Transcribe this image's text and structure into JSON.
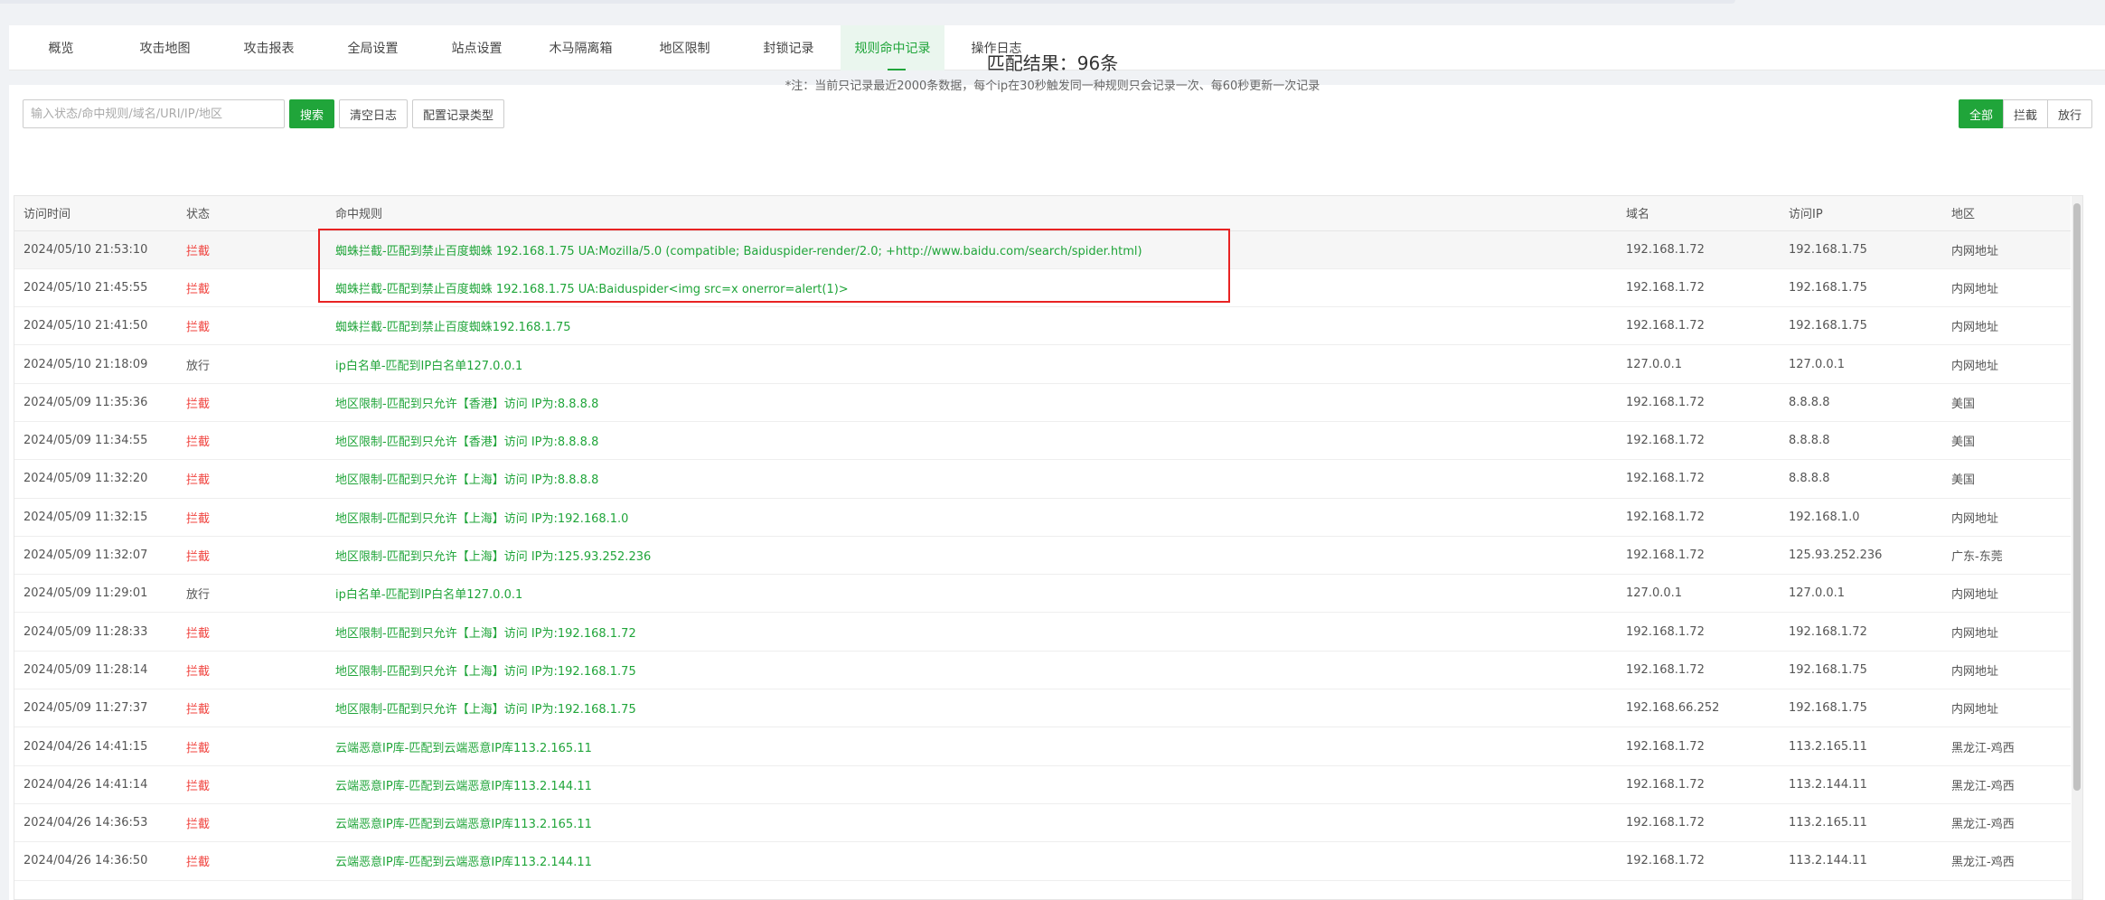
{
  "tabs": [
    "概览",
    "攻击地图",
    "攻击报表",
    "全局设置",
    "站点设置",
    "木马隔离箱",
    "地区限制",
    "封锁记录",
    "规则命中记录",
    "操作日志"
  ],
  "toolbar": {
    "search_placeholder": "输入状态/命中规则/域名/URI/IP/地区",
    "search_label": "搜索",
    "clear_label": "清空日志",
    "config_label": "配置记录类型"
  },
  "filters": [
    "全部",
    "拦截",
    "放行"
  ],
  "result": {
    "title": "匹配结果：96条",
    "note": "*注：当前只记录最近2000条数据，每个ip在30秒触发同一种规则只会记录一次、每60秒更新一次记录"
  },
  "columns": [
    "访问时间",
    "状态",
    "命中规则",
    "域名",
    "访问IP",
    "地区"
  ],
  "rows": [
    {
      "time": "2024/05/10 21:53:10",
      "status": "拦截",
      "rule": "蜘蛛拦截-匹配到禁止百度蜘蛛 192.168.1.75 UA:Mozilla/5.0 (compatible; Baiduspider-render/2.0; +http://www.baidu.com/search/spider.html)",
      "domain": "192.168.1.72",
      "ip": "192.168.1.75",
      "region": "内网地址"
    },
    {
      "time": "2024/05/10 21:45:55",
      "status": "拦截",
      "rule": "蜘蛛拦截-匹配到禁止百度蜘蛛 192.168.1.75 UA:Baiduspider<img src=x onerror=alert(1)>",
      "domain": "192.168.1.72",
      "ip": "192.168.1.75",
      "region": "内网地址"
    },
    {
      "time": "2024/05/10 21:41:50",
      "status": "拦截",
      "rule": "蜘蛛拦截-匹配到禁止百度蜘蛛192.168.1.75",
      "domain": "192.168.1.72",
      "ip": "192.168.1.75",
      "region": "内网地址"
    },
    {
      "time": "2024/05/10 21:18:09",
      "status": "放行",
      "rule": "ip白名单-匹配到IP白名单127.0.0.1",
      "domain": "127.0.0.1",
      "ip": "127.0.0.1",
      "region": "内网地址"
    },
    {
      "time": "2024/05/09 11:35:36",
      "status": "拦截",
      "rule": "地区限制-匹配到只允许【香港】访问 IP为:8.8.8.8",
      "domain": "192.168.1.72",
      "ip": "8.8.8.8",
      "region": "美国"
    },
    {
      "time": "2024/05/09 11:34:55",
      "status": "拦截",
      "rule": "地区限制-匹配到只允许【香港】访问 IP为:8.8.8.8",
      "domain": "192.168.1.72",
      "ip": "8.8.8.8",
      "region": "美国"
    },
    {
      "time": "2024/05/09 11:32:20",
      "status": "拦截",
      "rule": "地区限制-匹配到只允许【上海】访问 IP为:8.8.8.8",
      "domain": "192.168.1.72",
      "ip": "8.8.8.8",
      "region": "美国"
    },
    {
      "time": "2024/05/09 11:32:15",
      "status": "拦截",
      "rule": "地区限制-匹配到只允许【上海】访问 IP为:192.168.1.0",
      "domain": "192.168.1.72",
      "ip": "192.168.1.0",
      "region": "内网地址"
    },
    {
      "time": "2024/05/09 11:32:07",
      "status": "拦截",
      "rule": "地区限制-匹配到只允许【上海】访问 IP为:125.93.252.236",
      "domain": "192.168.1.72",
      "ip": "125.93.252.236",
      "region": "广东-东莞"
    },
    {
      "time": "2024/05/09 11:29:01",
      "status": "放行",
      "rule": "ip白名单-匹配到IP白名单127.0.0.1",
      "domain": "127.0.0.1",
      "ip": "127.0.0.1",
      "region": "内网地址"
    },
    {
      "time": "2024/05/09 11:28:33",
      "status": "拦截",
      "rule": "地区限制-匹配到只允许【上海】访问 IP为:192.168.1.72",
      "domain": "192.168.1.72",
      "ip": "192.168.1.72",
      "region": "内网地址"
    },
    {
      "time": "2024/05/09 11:28:14",
      "status": "拦截",
      "rule": "地区限制-匹配到只允许【上海】访问 IP为:192.168.1.75",
      "domain": "192.168.1.72",
      "ip": "192.168.1.75",
      "region": "内网地址"
    },
    {
      "time": "2024/05/09 11:27:37",
      "status": "拦截",
      "rule": "地区限制-匹配到只允许【上海】访问 IP为:192.168.1.75",
      "domain": "192.168.66.252",
      "ip": "192.168.1.75",
      "region": "内网地址"
    },
    {
      "time": "2024/04/26 14:41:15",
      "status": "拦截",
      "rule": "云端恶意IP库-匹配到云端恶意IP库113.2.165.11",
      "domain": "192.168.1.72",
      "ip": "113.2.165.11",
      "region": "黑龙江-鸡西"
    },
    {
      "time": "2024/04/26 14:41:14",
      "status": "拦截",
      "rule": "云端恶意IP库-匹配到云端恶意IP库113.2.144.11",
      "domain": "192.168.1.72",
      "ip": "113.2.144.11",
      "region": "黑龙江-鸡西"
    },
    {
      "time": "2024/04/26 14:36:53",
      "status": "拦截",
      "rule": "云端恶意IP库-匹配到云端恶意IP库113.2.165.11",
      "domain": "192.168.1.72",
      "ip": "113.2.165.11",
      "region": "黑龙江-鸡西"
    },
    {
      "time": "2024/04/26 14:36:50",
      "status": "拦截",
      "rule": "云端恶意IP库-匹配到云端恶意IP库113.2.144.11",
      "domain": "192.168.1.72",
      "ip": "113.2.144.11",
      "region": "黑龙江-鸡西"
    }
  ]
}
